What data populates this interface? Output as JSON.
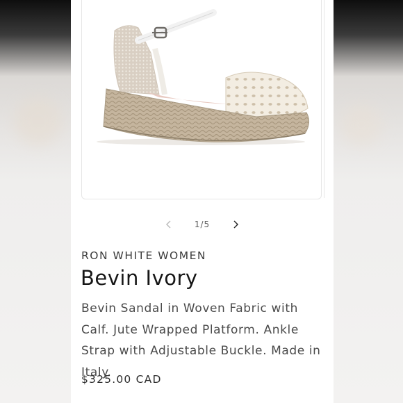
{
  "product": {
    "vendor": "RON WHITE WOMEN",
    "title": "Bevin Ivory",
    "description": "Bevin Sandal in Woven Fabric with Calf. Jute Wrapped Platform. Ankle Strap with Adjustable Buckle. Made in Italy.",
    "price": "$325.00 CAD"
  },
  "gallery": {
    "counter": "1/5",
    "current": 1,
    "total": 5,
    "prev_icon": "chevron-left-icon",
    "next_icon": "chevron-right-icon"
  }
}
